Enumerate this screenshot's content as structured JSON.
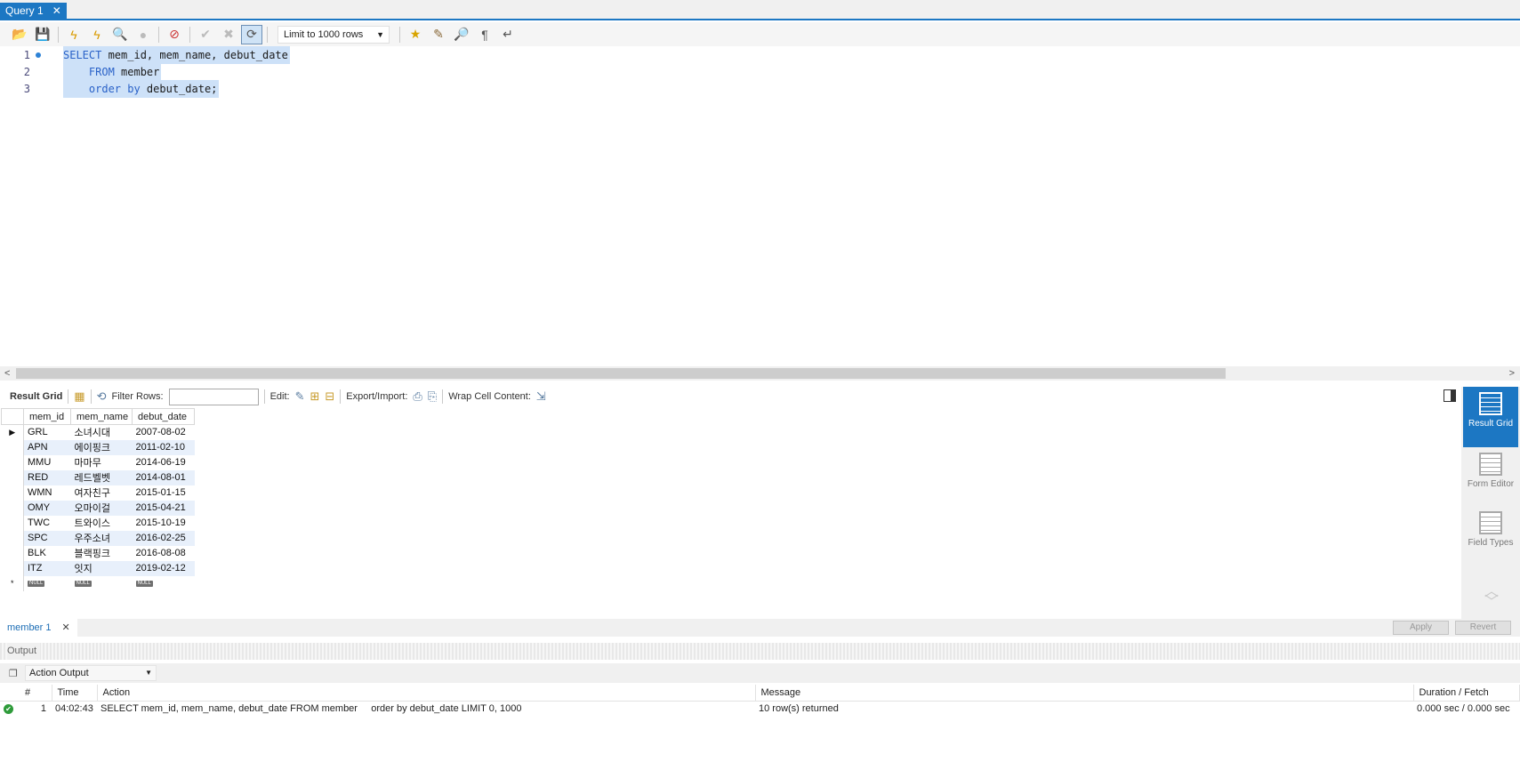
{
  "tab": {
    "title": "Query 1",
    "close_icon": "close-icon"
  },
  "toolbar": {
    "limit_label": "Limit to 1000 rows"
  },
  "editor": {
    "lines": [
      {
        "num": "1",
        "keyword": "SELECT",
        "rest": " mem_id, mem_name, debut_date"
      },
      {
        "num": "2",
        "keyword": "    FROM",
        "rest": " member"
      },
      {
        "num": "3",
        "keyword": "    order by",
        "rest": " debut_date;"
      }
    ]
  },
  "result_toolbar": {
    "result_grid_label": "Result Grid",
    "filter_label": "Filter Rows:",
    "filter_value": "",
    "edit_label": "Edit:",
    "export_label": "Export/Import:",
    "wrap_label": "Wrap Cell Content:"
  },
  "grid": {
    "columns": [
      "mem_id",
      "mem_name",
      "debut_date"
    ],
    "rows": [
      [
        "GRL",
        "소녀시대",
        "2007-08-02"
      ],
      [
        "APN",
        "에이핑크",
        "2011-02-10"
      ],
      [
        "MMU",
        "마마무",
        "2014-06-19"
      ],
      [
        "RED",
        "레드벨벳",
        "2014-08-01"
      ],
      [
        "WMN",
        "여자친구",
        "2015-01-15"
      ],
      [
        "OMY",
        "오마이걸",
        "2015-04-21"
      ],
      [
        "TWC",
        "트와이스",
        "2015-10-19"
      ],
      [
        "SPC",
        "우주소녀",
        "2016-02-25"
      ],
      [
        "BLK",
        "블랙핑크",
        "2016-08-08"
      ],
      [
        "ITZ",
        "잇지",
        "2019-02-12"
      ]
    ],
    "null_label": "NULL"
  },
  "side_panel": {
    "result_grid": "Result Grid",
    "form_editor": "Form Editor",
    "field_types": "Field Types"
  },
  "result_tab": {
    "label": "member 1",
    "apply": "Apply",
    "revert": "Revert"
  },
  "output": {
    "header": "Output",
    "selector": "Action Output",
    "columns": [
      "#",
      "Time",
      "Action",
      "Message",
      "Duration / Fetch"
    ],
    "rows": [
      {
        "num": "1",
        "time": "04:02:43",
        "action": "SELECT mem_id, mem_name, debut_date FROM member     order by debut_date LIMIT 0, 1000",
        "message": "10 row(s) returned",
        "duration": "0.000 sec / 0.000 sec"
      }
    ]
  },
  "colors": {
    "accent": "#1c77c3",
    "selection": "#cde1f8",
    "keyword": "#2a62c8",
    "success": "#2e9b3a"
  }
}
